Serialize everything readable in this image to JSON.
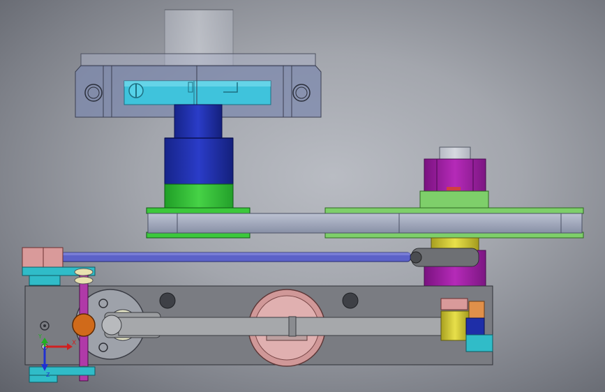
{
  "viewport": {
    "background": "#9ea1a8",
    "triad": {
      "x_label": "X",
      "y_label": "Y",
      "z_label": "Z"
    }
  },
  "colors": {
    "frame_gray": "#7a7c82",
    "clamp_blue": "#7e8aad",
    "clamp_cyan": "#3fc3dc",
    "shaft_navy": "#1e2ea8",
    "pulley_green": "#3cc83c",
    "pulley_light_green": "#7ecf6a",
    "belt_gray": "#9da4b8",
    "block_magenta": "#a020a0",
    "sleeve_yellow": "#d8d23a",
    "rod_blue": "#5c62c8",
    "pink_part": "#d99a9a",
    "link_gray": "#9a9c9f",
    "cam_pink": "#e0a8a8",
    "pin_orange": "#d06a1a",
    "post_purple": "#b03aa8",
    "bracket_cyan": "#30bcc8"
  },
  "parts": [
    "top-clamp-housing",
    "navy-spindle",
    "green-drive-pulley",
    "belt",
    "magenta-motor-block",
    "connecting-rod",
    "base-frame",
    "crank-disc",
    "cam-wheel",
    "lever-link",
    "coordinate-triad"
  ]
}
